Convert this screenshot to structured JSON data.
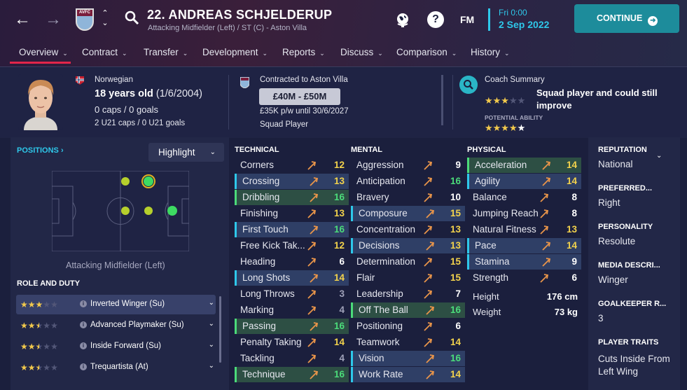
{
  "topbar": {
    "club_abbr": "AVFC",
    "player_title": "22. ANDREAS SCHJELDERUP",
    "player_subtitle": "Attacking Midfielder (Left) / ST (C) - Aston Villa",
    "help_label": "?",
    "fm_label": "FM",
    "time": "Fri 0:00",
    "date": "2 Sep 2022",
    "continue_label": "CONTINUE",
    "accent": "#2ec8ea",
    "continue_color": "#1d8c9b"
  },
  "tabs": [
    {
      "label": "Overview"
    },
    {
      "label": "Contract"
    },
    {
      "label": "Transfer"
    },
    {
      "label": "Development"
    },
    {
      "label": "Reports"
    },
    {
      "label": "Discuss"
    },
    {
      "label": "Comparison"
    },
    {
      "label": "History"
    }
  ],
  "header": {
    "nationality": "Norwegian",
    "age": "18 years old",
    "dob": "(1/6/2004)",
    "caps": "0 caps / 0 goals",
    "u21_caps": "2 U21 caps / 0 U21 goals",
    "contract": "Contracted to Aston Villa",
    "value": "£40M - £50M",
    "wage": "£35K p/w until 30/6/2027",
    "squad_status": "Squad Player",
    "coach_title": "Coach Summary",
    "coach_summary": "Squad player and could still improve",
    "current_ability_stars": 3,
    "potential_label": "POTENTIAL ABILITY",
    "potential_ability_stars": 4.5
  },
  "positions": {
    "link_label": "POSITIONS",
    "highlight_label": "Highlight",
    "caption": "Attacking Midfielder (Left)"
  },
  "roles": {
    "title": "ROLE AND DUTY",
    "items": [
      {
        "name": "Inverted Winger (Su)",
        "stars": 3,
        "selected": true
      },
      {
        "name": "Advanced Playmaker (Su)",
        "stars": 2.5,
        "selected": false
      },
      {
        "name": "Inside Forward (Su)",
        "stars": 2.5,
        "selected": false
      },
      {
        "name": "Trequartista (At)",
        "stars": 2.5,
        "selected": false
      }
    ]
  },
  "technical": {
    "title": "TECHNICAL",
    "attrs": [
      {
        "name": "Corners",
        "value": "12",
        "hl": "none"
      },
      {
        "name": "Crossing",
        "value": "13",
        "hl": "blue"
      },
      {
        "name": "Dribbling",
        "value": "16",
        "hl": "green"
      },
      {
        "name": "Finishing",
        "value": "13",
        "hl": "none"
      },
      {
        "name": "First Touch",
        "value": "16",
        "hl": "blue"
      },
      {
        "name": "Free Kick Tak...",
        "value": "12",
        "hl": "none"
      },
      {
        "name": "Heading",
        "value": "6",
        "hl": "none"
      },
      {
        "name": "Long Shots",
        "value": "14",
        "hl": "blue"
      },
      {
        "name": "Long Throws",
        "value": "3",
        "hl": "none"
      },
      {
        "name": "Marking",
        "value": "4",
        "hl": "none"
      },
      {
        "name": "Passing",
        "value": "16",
        "hl": "green"
      },
      {
        "name": "Penalty Taking",
        "value": "14",
        "hl": "none"
      },
      {
        "name": "Tackling",
        "value": "4",
        "hl": "none"
      },
      {
        "name": "Technique",
        "value": "16",
        "hl": "green"
      }
    ]
  },
  "mental": {
    "title": "MENTAL",
    "attrs": [
      {
        "name": "Aggression",
        "value": "9",
        "hl": "none"
      },
      {
        "name": "Anticipation",
        "value": "16",
        "hl": "none"
      },
      {
        "name": "Bravery",
        "value": "10",
        "hl": "none"
      },
      {
        "name": "Composure",
        "value": "15",
        "hl": "blue"
      },
      {
        "name": "Concentration",
        "value": "13",
        "hl": "none"
      },
      {
        "name": "Decisions",
        "value": "13",
        "hl": "blue"
      },
      {
        "name": "Determination",
        "value": "15",
        "hl": "none"
      },
      {
        "name": "Flair",
        "value": "15",
        "hl": "none"
      },
      {
        "name": "Leadership",
        "value": "7",
        "hl": "none"
      },
      {
        "name": "Off The Ball",
        "value": "16",
        "hl": "green"
      },
      {
        "name": "Positioning",
        "value": "6",
        "hl": "none"
      },
      {
        "name": "Teamwork",
        "value": "14",
        "hl": "none"
      },
      {
        "name": "Vision",
        "value": "16",
        "hl": "blue"
      },
      {
        "name": "Work Rate",
        "value": "14",
        "hl": "blue"
      }
    ]
  },
  "physical": {
    "title": "PHYSICAL",
    "attrs": [
      {
        "name": "Acceleration",
        "value": "14",
        "hl": "green"
      },
      {
        "name": "Agility",
        "value": "14",
        "hl": "blue"
      },
      {
        "name": "Balance",
        "value": "8",
        "hl": "none"
      },
      {
        "name": "Jumping Reach",
        "value": "8",
        "hl": "none"
      },
      {
        "name": "Natural Fitness",
        "value": "13",
        "hl": "none"
      },
      {
        "name": "Pace",
        "value": "14",
        "hl": "blue"
      },
      {
        "name": "Stamina",
        "value": "9",
        "hl": "blue"
      },
      {
        "name": "Strength",
        "value": "6",
        "hl": "none"
      }
    ],
    "height_label": "Height",
    "height": "176 cm",
    "weight_label": "Weight",
    "weight": "73 kg"
  },
  "info": {
    "reputation_h": "REPUTATION",
    "reputation": "National",
    "foot_h": "PREFERRED...",
    "foot": "Right",
    "personality_h": "PERSONALITY",
    "personality": "Resolute",
    "media_h": "MEDIA DESCRI...",
    "media": "Winger",
    "gk_h": "GOALKEEPER R...",
    "gk": "3",
    "traits_h": "PLAYER TRAITS",
    "traits": "Cuts Inside From Left Wing"
  }
}
